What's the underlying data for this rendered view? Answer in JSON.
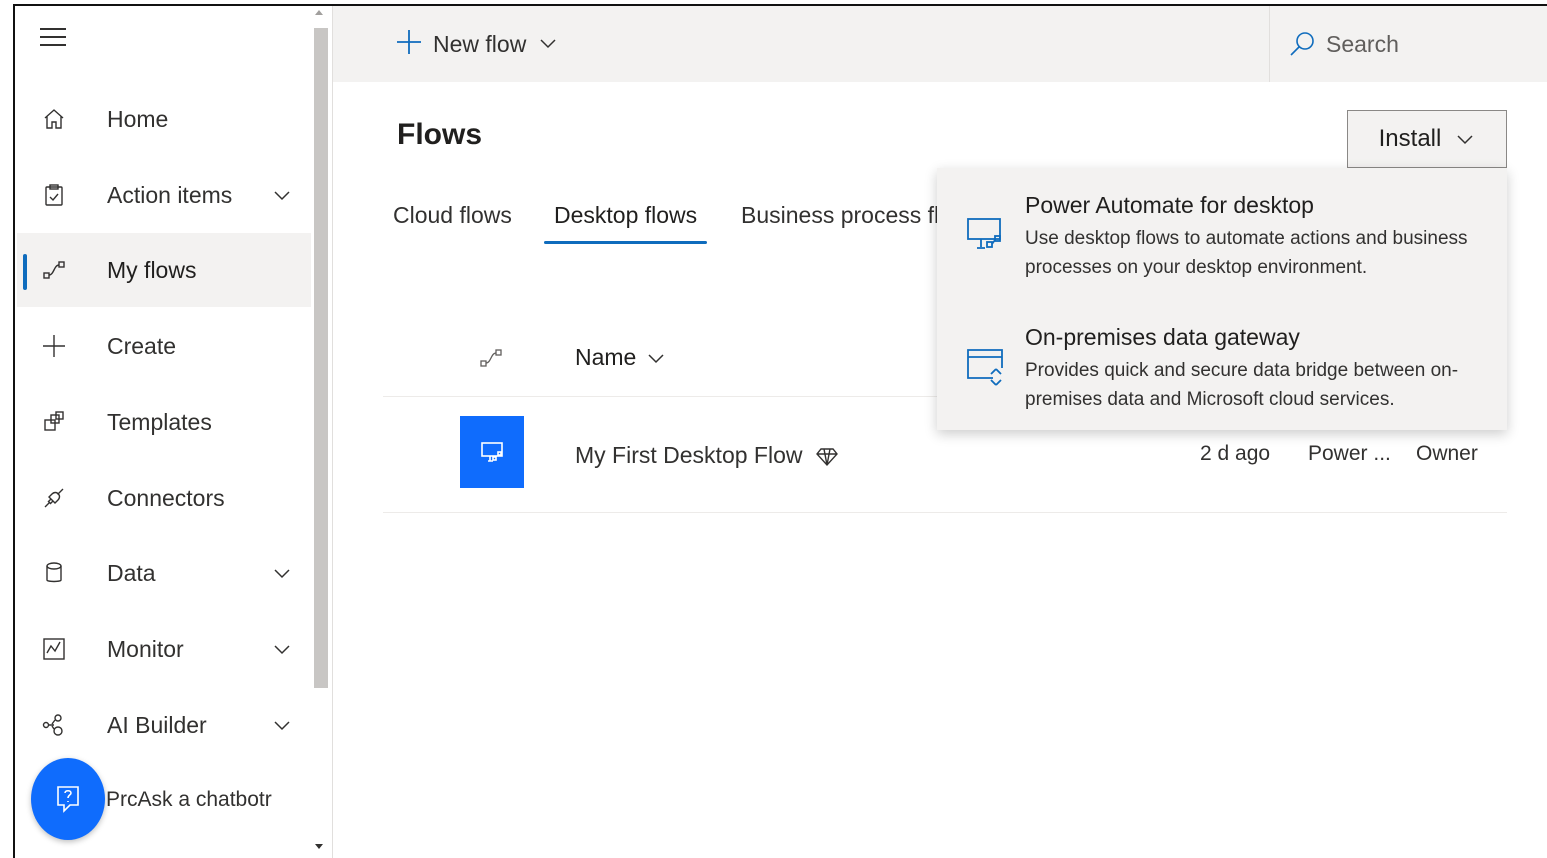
{
  "topbar": {
    "new_flow_label": "New flow",
    "search_placeholder": "Search"
  },
  "sidebar": {
    "items": [
      {
        "label": "Home",
        "icon": "home-icon",
        "has_chevron": false
      },
      {
        "label": "Action items",
        "icon": "clipboard-icon",
        "has_chevron": true
      },
      {
        "label": "My flows",
        "icon": "flow-icon",
        "has_chevron": false,
        "active": true
      },
      {
        "label": "Create",
        "icon": "plus-icon",
        "has_chevron": false
      },
      {
        "label": "Templates",
        "icon": "templates-icon",
        "has_chevron": false
      },
      {
        "label": "Connectors",
        "icon": "connector-icon",
        "has_chevron": false
      },
      {
        "label": "Data",
        "icon": "database-icon",
        "has_chevron": true
      },
      {
        "label": "Monitor",
        "icon": "monitor-chart-icon",
        "has_chevron": true
      },
      {
        "label": "AI Builder",
        "icon": "ai-builder-icon",
        "has_chevron": true
      }
    ],
    "chatbot_text": "PrcAsk a chatbotr"
  },
  "main": {
    "title": "Flows",
    "tabs": [
      {
        "label": "Cloud flows"
      },
      {
        "label": "Desktop flows",
        "active": true
      },
      {
        "label": "Business process flo"
      }
    ],
    "install_label": "Install",
    "list": {
      "column_name": "Name",
      "rows": [
        {
          "name": "My First Desktop Flow",
          "modified": "2 d ago",
          "type": "Power ...",
          "owner": "Owner"
        }
      ]
    }
  },
  "install_menu": {
    "items": [
      {
        "title": "Power Automate for desktop",
        "description": "Use desktop flows to automate actions and business processes on your desktop environment.",
        "icon": "desktop-flow-icon"
      },
      {
        "title": "On-premises data gateway",
        "description": "Provides quick and secure data bridge between on-premises data and Microsoft cloud services.",
        "icon": "gateway-icon"
      }
    ]
  },
  "colors": {
    "accent": "#0f6cbd",
    "tile_blue": "#0f6cfd",
    "topbar_bg": "#f3f2f1"
  }
}
